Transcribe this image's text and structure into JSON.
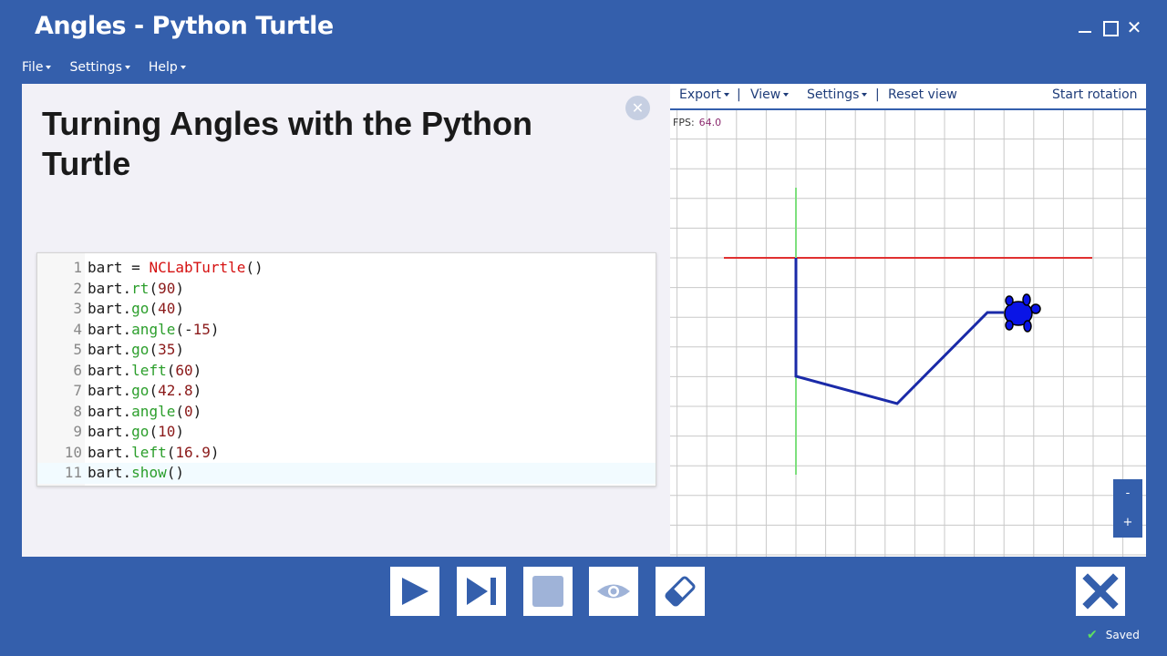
{
  "window": {
    "title": "Angles - Python Turtle",
    "close_glyph": "✕"
  },
  "menu": {
    "items": [
      {
        "label": "File"
      },
      {
        "label": "Settings"
      },
      {
        "label": "Help"
      }
    ]
  },
  "left_pane": {
    "heading": "Turning Angles with the Python Turtle",
    "close_glyph": "✕"
  },
  "editor": {
    "active_line": 11,
    "lines": [
      {
        "num": "1",
        "tokens": [
          [
            "p",
            "bart = "
          ],
          [
            "cls",
            "NCLabTurtle"
          ],
          [
            "p",
            "()"
          ]
        ]
      },
      {
        "num": "2",
        "tokens": [
          [
            "p",
            "bart."
          ],
          [
            "fn",
            "rt"
          ],
          [
            "p",
            "("
          ],
          [
            "num",
            "90"
          ],
          [
            "p",
            ")"
          ]
        ]
      },
      {
        "num": "3",
        "tokens": [
          [
            "p",
            "bart."
          ],
          [
            "fn",
            "go"
          ],
          [
            "p",
            "("
          ],
          [
            "num",
            "40"
          ],
          [
            "p",
            ")"
          ]
        ]
      },
      {
        "num": "4",
        "tokens": [
          [
            "p",
            "bart."
          ],
          [
            "fn",
            "angle"
          ],
          [
            "p",
            "(-"
          ],
          [
            "num",
            "15"
          ],
          [
            "p",
            ")"
          ]
        ]
      },
      {
        "num": "5",
        "tokens": [
          [
            "p",
            "bart."
          ],
          [
            "fn",
            "go"
          ],
          [
            "p",
            "("
          ],
          [
            "num",
            "35"
          ],
          [
            "p",
            ")"
          ]
        ]
      },
      {
        "num": "6",
        "tokens": [
          [
            "p",
            "bart."
          ],
          [
            "fn",
            "left"
          ],
          [
            "p",
            "("
          ],
          [
            "num",
            "60"
          ],
          [
            "p",
            ")"
          ]
        ]
      },
      {
        "num": "7",
        "tokens": [
          [
            "p",
            "bart."
          ],
          [
            "fn",
            "go"
          ],
          [
            "p",
            "("
          ],
          [
            "num",
            "42.8"
          ],
          [
            "p",
            ")"
          ]
        ]
      },
      {
        "num": "8",
        "tokens": [
          [
            "p",
            "bart."
          ],
          [
            "fn",
            "angle"
          ],
          [
            "p",
            "("
          ],
          [
            "num",
            "0"
          ],
          [
            "p",
            ")"
          ]
        ]
      },
      {
        "num": "9",
        "tokens": [
          [
            "p",
            "bart."
          ],
          [
            "fn",
            "go"
          ],
          [
            "p",
            "("
          ],
          [
            "num",
            "10"
          ],
          [
            "p",
            ")"
          ]
        ]
      },
      {
        "num": "10",
        "tokens": [
          [
            "p",
            "bart."
          ],
          [
            "fn",
            "left"
          ],
          [
            "p",
            "("
          ],
          [
            "num",
            "16.9"
          ],
          [
            "p",
            ")"
          ]
        ]
      },
      {
        "num": "11",
        "tokens": [
          [
            "p",
            "bart."
          ],
          [
            "fn",
            "show"
          ],
          [
            "p",
            "()"
          ]
        ]
      }
    ]
  },
  "viewer": {
    "toolbar": {
      "export": "Export",
      "view": "View",
      "settings": "Settings",
      "reset_view": "Reset view",
      "start_rotation": "Start rotation",
      "separator": "|"
    },
    "fps_label": "FPS:",
    "fps_value": "64.0",
    "zoom_out": "-",
    "zoom_in": "+",
    "colors": {
      "grid": "#c8c8c8",
      "x_axis": "#e03030",
      "y_axis": "#7ee07e",
      "path": "#1a2aa8",
      "turtle": "#0a14e6"
    }
  },
  "bottom_bar": {
    "buttons": [
      {
        "name": "play-button",
        "icon": "play-icon"
      },
      {
        "name": "step-button",
        "icon": "step-forward-icon"
      },
      {
        "name": "stop-button",
        "icon": "stop-icon"
      },
      {
        "name": "view-button",
        "icon": "eye-icon"
      },
      {
        "name": "erase-button",
        "icon": "eraser-icon"
      },
      {
        "name": "exit-button",
        "icon": "close-icon"
      }
    ],
    "saved_label": "Saved",
    "saved_check": "✔"
  }
}
